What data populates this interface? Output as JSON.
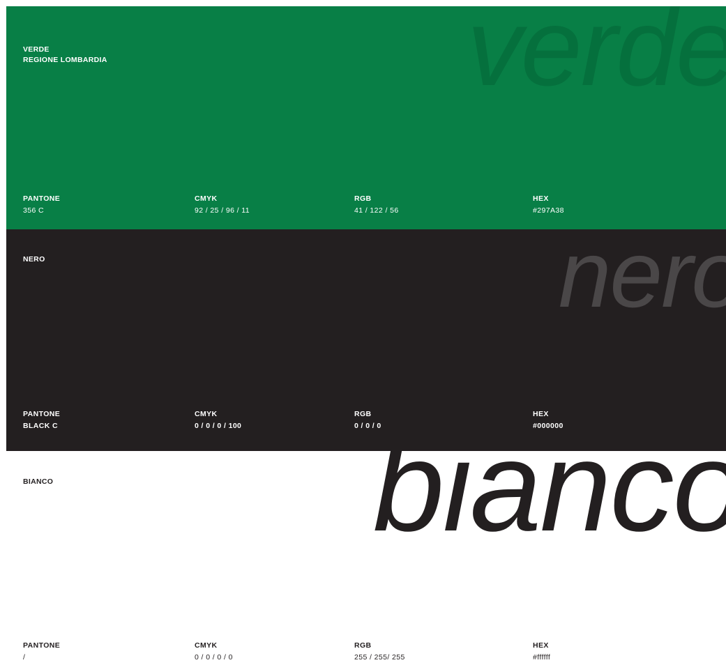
{
  "colors": {
    "verde_bg": "#087F46",
    "verde_word": "#05703D",
    "nero_bg": "#231F20",
    "nero_word": "#4A4748",
    "bianco_bg": "#FFFFFF",
    "bianco_word": "#231F20",
    "light_text": "#FFFFFF",
    "dark_text": "#231F20"
  },
  "swatches": [
    {
      "big_word": "verde",
      "name_line1": "VERDE",
      "name_line2": "REGIONE LOMBARDIA",
      "pantone_label": "PANTONE",
      "pantone_value": "356 C",
      "cmyk_label": "CMYK",
      "cmyk_value": "92 / 25 / 96 / 11",
      "rgb_label": "RGB",
      "rgb_value": "41 / 122 / 56",
      "hex_label": "HEX",
      "hex_value": "#297A38"
    },
    {
      "big_word": "nero",
      "name_line1": "NERO",
      "name_line2": "",
      "pantone_label": "PANTONE",
      "pantone_value": "BLACK C",
      "cmyk_label": "CMYK",
      "cmyk_value": "0 / 0 / 0 / 100",
      "rgb_label": "RGB",
      "rgb_value": "0 / 0 / 0",
      "hex_label": "HEX",
      "hex_value": "#000000"
    },
    {
      "big_word": "bianco",
      "name_line1": "BIANCO",
      "name_line2": "",
      "pantone_label": "PANTONE",
      "pantone_value": "/",
      "cmyk_label": "CMYK",
      "cmyk_value": "0 / 0 / 0 / 0",
      "rgb_label": "RGB",
      "rgb_value": "255 / 255/ 255",
      "hex_label": "HEX",
      "hex_value": "#ffffff"
    }
  ]
}
